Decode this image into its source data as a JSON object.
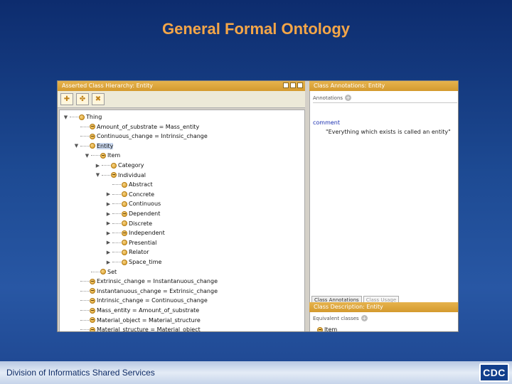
{
  "slide": {
    "title": "General Formal Ontology",
    "footer": "Division of Informatics Shared Services",
    "logo_text": "CDC",
    "title_color": "#f4a648"
  },
  "hierarchy_panel": {
    "header": "Asserted Class Hierarchy: Entity",
    "toolbar_icons": [
      "add-subclass-icon",
      "add-sibling-icon",
      "delete-class-icon"
    ],
    "tree": [
      {
        "depth": 0,
        "toggle": "expanded",
        "label": "Thing",
        "defined": false
      },
      {
        "depth": 1,
        "toggle": "none",
        "label": "Amount_of_substrate = Mass_entity",
        "defined": true
      },
      {
        "depth": 1,
        "toggle": "none",
        "label": "Continuous_change = Intrinsic_change",
        "defined": true
      },
      {
        "depth": 1,
        "toggle": "expanded",
        "label": "Entity",
        "defined": false,
        "selected": true
      },
      {
        "depth": 2,
        "toggle": "expanded",
        "label": "Item",
        "defined": true
      },
      {
        "depth": 3,
        "toggle": "collapsed",
        "label": "Category",
        "defined": false
      },
      {
        "depth": 3,
        "toggle": "expanded",
        "label": "Individual",
        "defined": true
      },
      {
        "depth": 4,
        "toggle": "none",
        "label": "Abstract",
        "defined": false
      },
      {
        "depth": 4,
        "toggle": "collapsed",
        "label": "Concrete",
        "defined": false
      },
      {
        "depth": 4,
        "toggle": "collapsed",
        "label": "Continuous",
        "defined": false
      },
      {
        "depth": 4,
        "toggle": "collapsed",
        "label": "Dependent",
        "defined": true
      },
      {
        "depth": 4,
        "toggle": "collapsed",
        "label": "Discrete",
        "defined": false
      },
      {
        "depth": 4,
        "toggle": "collapsed",
        "label": "Independent",
        "defined": true
      },
      {
        "depth": 4,
        "toggle": "collapsed",
        "label": "Presential",
        "defined": false
      },
      {
        "depth": 4,
        "toggle": "collapsed",
        "label": "Relator",
        "defined": false
      },
      {
        "depth": 4,
        "toggle": "collapsed",
        "label": "Space_time",
        "defined": false
      },
      {
        "depth": 2,
        "toggle": "none",
        "label": "Set",
        "defined": false
      },
      {
        "depth": 1,
        "toggle": "none",
        "label": "Extrinsic_change = Instantanuous_change",
        "defined": true
      },
      {
        "depth": 1,
        "toggle": "none",
        "label": "Instantanuous_change = Extrinsic_change",
        "defined": true
      },
      {
        "depth": 1,
        "toggle": "none",
        "label": "Intrinsic_change = Continuous_change",
        "defined": true
      },
      {
        "depth": 1,
        "toggle": "none",
        "label": "Mass_entity = Amount_of_substrate",
        "defined": true
      },
      {
        "depth": 1,
        "toggle": "none",
        "label": "Material_object = Material_structure",
        "defined": true
      },
      {
        "depth": 1,
        "toggle": "none",
        "label": "Material_structure = Material_object",
        "defined": true
      }
    ]
  },
  "annotations_panel": {
    "header": "Class Annotations: Entity",
    "section_label": "Annotations",
    "comment_key": "comment",
    "comment_value": "\"Everything which exists is called an entity\"",
    "tabs": [
      "Class Annotations",
      "Class Usage"
    ]
  },
  "description_panel": {
    "header": "Class Description: Entity",
    "section_label": "Equivalent classes",
    "first_item": "Item"
  }
}
